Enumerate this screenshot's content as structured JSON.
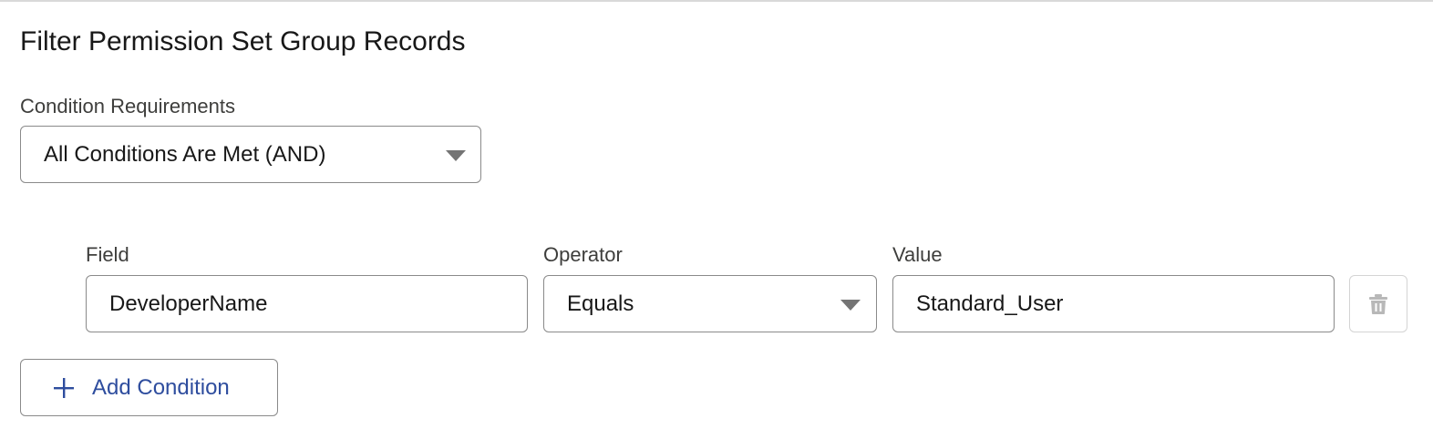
{
  "title": "Filter Permission Set Group Records",
  "condition_requirements": {
    "label": "Condition Requirements",
    "selected": "All Conditions Are Met (AND)"
  },
  "condition_row": {
    "field_label": "Field",
    "field_value": "DeveloperName",
    "operator_label": "Operator",
    "operator_value": "Equals",
    "value_label": "Value",
    "value_value": "Standard_User"
  },
  "add_condition": {
    "label": "Add Condition"
  },
  "icons": {
    "caret": "chevron-down-icon",
    "delete": "trash-icon",
    "add": "plus-icon"
  },
  "colors": {
    "accent": "#2e4d9e",
    "border": "#8a8a8a",
    "disabled_border": "#d4d4d4",
    "icon_gray": "#747474",
    "disabled_icon": "#b8b8b8"
  }
}
